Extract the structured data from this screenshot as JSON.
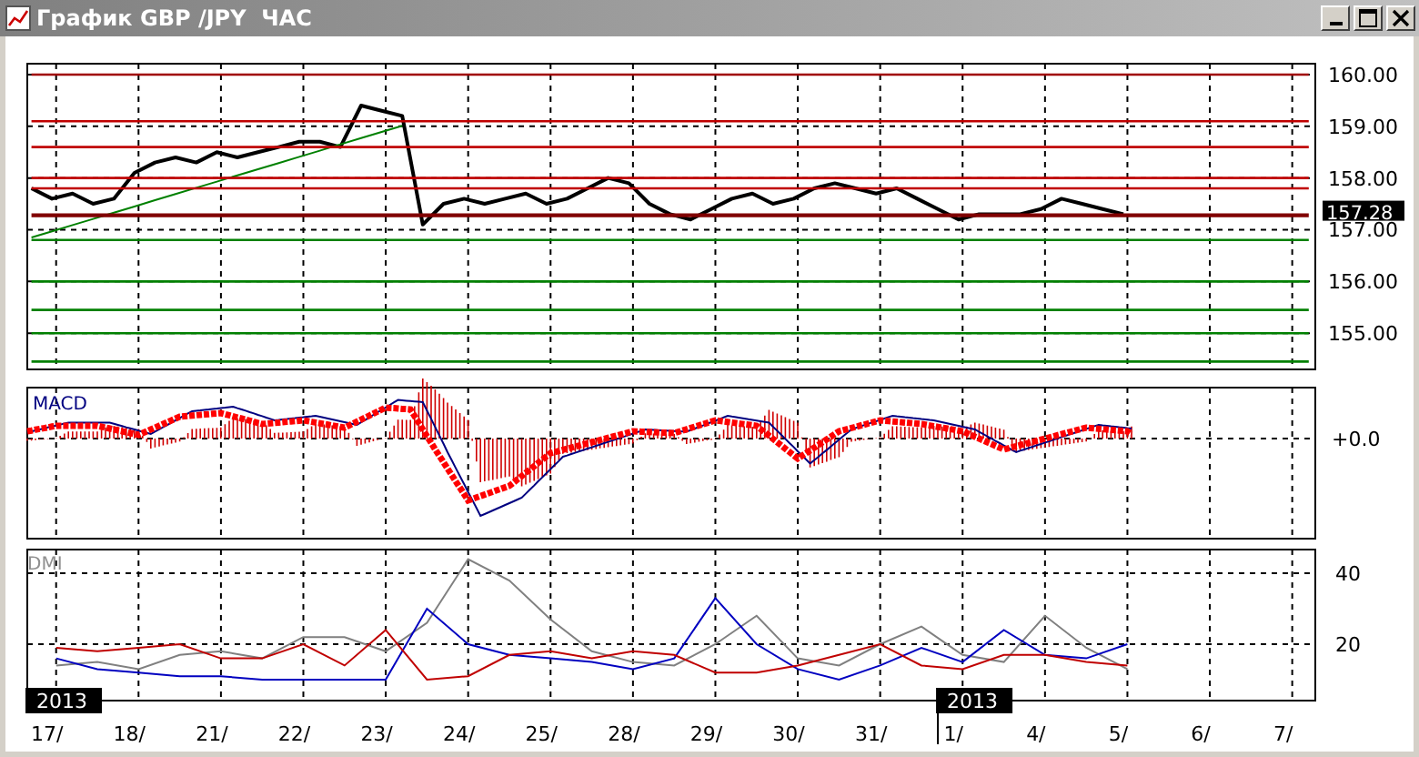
{
  "window": {
    "title": "График GBP /JPY  ЧАС"
  },
  "price_pane": {
    "last_price_label": "157.28",
    "chart_data": {
      "type": "line",
      "categories": [
        null,
        null,
        null,
        null,
        null,
        null,
        null,
        null,
        null,
        null,
        null,
        null,
        null,
        null,
        null,
        null,
        null,
        null,
        null,
        null,
        null,
        null,
        null,
        null,
        null,
        null,
        null,
        null,
        null,
        null,
        null,
        null,
        null,
        null,
        null,
        null,
        null,
        null,
        null,
        null,
        null,
        null,
        null,
        null,
        null,
        null,
        null,
        null,
        null,
        null,
        null,
        null,
        null,
        null,
        null,
        null,
        null,
        null,
        null,
        null,
        null,
        null,
        null
      ],
      "series": [
        {
          "color": "#000000",
          "values": [
            157.8,
            157.6,
            157.7,
            157.5,
            157.6,
            158.1,
            158.3,
            158.4,
            158.3,
            158.5,
            158.4,
            158.5,
            158.6,
            158.7,
            158.7,
            158.6,
            159.4,
            159.3,
            159.2,
            157.1,
            157.5,
            157.6,
            157.5,
            157.6,
            157.7,
            157.5,
            157.6,
            157.8,
            158.0,
            157.9,
            157.5,
            157.3,
            157.2,
            157.4,
            157.6,
            157.7,
            157.5,
            157.6,
            157.8,
            157.9,
            157.8,
            157.7,
            157.8,
            157.6,
            157.4,
            157.2,
            157.3,
            157.3,
            157.3,
            157.4,
            157.6,
            157.5,
            157.4,
            157.3,
            null,
            null,
            null,
            null,
            null,
            null,
            null,
            null,
            null
          ]
        },
        {
          "color": "#008000",
          "values": [
            156.85,
            156.97,
            157.09,
            157.21,
            157.33,
            157.45,
            157.57,
            157.69,
            157.81,
            157.93,
            158.05,
            158.17,
            158.29,
            158.41,
            158.53,
            158.65,
            158.77,
            158.89,
            159.01,
            null,
            null,
            null,
            null,
            null,
            null,
            null,
            null,
            null,
            null,
            null,
            null,
            null,
            null,
            null,
            null,
            null,
            null,
            null,
            null,
            null,
            null,
            null,
            null,
            null,
            null,
            null,
            null,
            null,
            null,
            null,
            null,
            null,
            null,
            null,
            null,
            null,
            null,
            null,
            null,
            null,
            null,
            null,
            null
          ]
        },
        {
          "color": "#a00000",
          "values": [
            160,
            160,
            160,
            160,
            160,
            160,
            160,
            160,
            160,
            160,
            160,
            160,
            160,
            160,
            160,
            160,
            160,
            160,
            160,
            160,
            160,
            160,
            160,
            160,
            160,
            160,
            160,
            160,
            160,
            160,
            160,
            160,
            160,
            160,
            160,
            160,
            160,
            160,
            160,
            160,
            160,
            160,
            160,
            160,
            160,
            160,
            160,
            160,
            160,
            160,
            160,
            160,
            160,
            160,
            160,
            160,
            160,
            160,
            160,
            160,
            160,
            160,
            160
          ]
        },
        {
          "color": "#c00000",
          "values": [
            159.1,
            159.1,
            159.1,
            159.1,
            159.1,
            159.1,
            159.1,
            159.1,
            159.1,
            159.1,
            159.1,
            159.1,
            159.1,
            159.1,
            159.1,
            159.1,
            159.1,
            159.1,
            159.1,
            159.1,
            159.1,
            159.1,
            159.1,
            159.1,
            159.1,
            159.1,
            159.1,
            159.1,
            159.1,
            159.1,
            159.1,
            159.1,
            159.1,
            159.1,
            159.1,
            159.1,
            159.1,
            159.1,
            159.1,
            159.1,
            159.1,
            159.1,
            159.1,
            159.1,
            159.1,
            159.1,
            159.1,
            159.1,
            159.1,
            159.1,
            159.1,
            159.1,
            159.1,
            159.1,
            159.1,
            159.1,
            159.1,
            159.1,
            159.1,
            159.1,
            159.1,
            159.1,
            159.1
          ]
        },
        {
          "color": "#c00000",
          "values": [
            158.6,
            158.6,
            158.6,
            158.6,
            158.6,
            158.6,
            158.6,
            158.6,
            158.6,
            158.6,
            158.6,
            158.6,
            158.6,
            158.6,
            158.6,
            158.6,
            158.6,
            158.6,
            158.6,
            158.6,
            158.6,
            158.6,
            158.6,
            158.6,
            158.6,
            158.6,
            158.6,
            158.6,
            158.6,
            158.6,
            158.6,
            158.6,
            158.6,
            158.6,
            158.6,
            158.6,
            158.6,
            158.6,
            158.6,
            158.6,
            158.6,
            158.6,
            158.6,
            158.6,
            158.6,
            158.6,
            158.6,
            158.6,
            158.6,
            158.6,
            158.6,
            158.6,
            158.6,
            158.6,
            158.6,
            158.6,
            158.6,
            158.6,
            158.6,
            158.6,
            158.6,
            158.6,
            158.6
          ]
        },
        {
          "color": "#c00000",
          "values": [
            158,
            158,
            158,
            158,
            158,
            158,
            158,
            158,
            158,
            158,
            158,
            158,
            158,
            158,
            158,
            158,
            158,
            158,
            158,
            158,
            158,
            158,
            158,
            158,
            158,
            158,
            158,
            158,
            158,
            158,
            158,
            158,
            158,
            158,
            158,
            158,
            158,
            158,
            158,
            158,
            158,
            158,
            158,
            158,
            158,
            158,
            158,
            158,
            158,
            158,
            158,
            158,
            158,
            158,
            158,
            158,
            158,
            158,
            158,
            158,
            158,
            158,
            158
          ]
        },
        {
          "color": "#c00000",
          "values": [
            157.8,
            157.8,
            157.8,
            157.8,
            157.8,
            157.8,
            157.8,
            157.8,
            157.8,
            157.8,
            157.8,
            157.8,
            157.8,
            157.8,
            157.8,
            157.8,
            157.8,
            157.8,
            157.8,
            157.8,
            157.8,
            157.8,
            157.8,
            157.8,
            157.8,
            157.8,
            157.8,
            157.8,
            157.8,
            157.8,
            157.8,
            157.8,
            157.8,
            157.8,
            157.8,
            157.8,
            157.8,
            157.8,
            157.8,
            157.8,
            157.8,
            157.8,
            157.8,
            157.8,
            157.8,
            157.8,
            157.8,
            157.8,
            157.8,
            157.8,
            157.8,
            157.8,
            157.8,
            157.8,
            157.8,
            157.8,
            157.8,
            157.8,
            157.8,
            157.8,
            157.8,
            157.8,
            157.8
          ]
        },
        {
          "color": "#800000",
          "values": [
            157.28,
            157.28,
            157.28,
            157.28,
            157.28,
            157.28,
            157.28,
            157.28,
            157.28,
            157.28,
            157.28,
            157.28,
            157.28,
            157.28,
            157.28,
            157.28,
            157.28,
            157.28,
            157.28,
            157.28,
            157.28,
            157.28,
            157.28,
            157.28,
            157.28,
            157.28,
            157.28,
            157.28,
            157.28,
            157.28,
            157.28,
            157.28,
            157.28,
            157.28,
            157.28,
            157.28,
            157.28,
            157.28,
            157.28,
            157.28,
            157.28,
            157.28,
            157.28,
            157.28,
            157.28,
            157.28,
            157.28,
            157.28,
            157.28,
            157.28,
            157.28,
            157.28,
            157.28,
            157.28,
            157.28,
            157.28,
            157.28,
            157.28,
            157.28,
            157.28,
            157.28,
            157.28,
            157.28
          ]
        },
        {
          "color": "#008000",
          "values": [
            156.8,
            156.8,
            156.8,
            156.8,
            156.8,
            156.8,
            156.8,
            156.8,
            156.8,
            156.8,
            156.8,
            156.8,
            156.8,
            156.8,
            156.8,
            156.8,
            156.8,
            156.8,
            156.8,
            156.8,
            156.8,
            156.8,
            156.8,
            156.8,
            156.8,
            156.8,
            156.8,
            156.8,
            156.8,
            156.8,
            156.8,
            156.8,
            156.8,
            156.8,
            156.8,
            156.8,
            156.8,
            156.8,
            156.8,
            156.8,
            156.8,
            156.8,
            156.8,
            156.8,
            156.8,
            156.8,
            156.8,
            156.8,
            156.8,
            156.8,
            156.8,
            156.8,
            156.8,
            156.8,
            156.8,
            156.8,
            156.8,
            156.8,
            156.8,
            156.8,
            156.8,
            156.8,
            156.8
          ]
        },
        {
          "color": "#008000",
          "values": [
            156,
            156,
            156,
            156,
            156,
            156,
            156,
            156,
            156,
            156,
            156,
            156,
            156,
            156,
            156,
            156,
            156,
            156,
            156,
            156,
            156,
            156,
            156,
            156,
            156,
            156,
            156,
            156,
            156,
            156,
            156,
            156,
            156,
            156,
            156,
            156,
            156,
            156,
            156,
            156,
            156,
            156,
            156,
            156,
            156,
            156,
            156,
            156,
            156,
            156,
            156,
            156,
            156,
            156,
            156,
            156,
            156,
            156,
            156,
            156,
            156,
            156,
            156
          ]
        },
        {
          "color": "#008000",
          "values": [
            155.45,
            155.45,
            155.45,
            155.45,
            155.45,
            155.45,
            155.45,
            155.45,
            155.45,
            155.45,
            155.45,
            155.45,
            155.45,
            155.45,
            155.45,
            155.45,
            155.45,
            155.45,
            155.45,
            155.45,
            155.45,
            155.45,
            155.45,
            155.45,
            155.45,
            155.45,
            155.45,
            155.45,
            155.45,
            155.45,
            155.45,
            155.45,
            155.45,
            155.45,
            155.45,
            155.45,
            155.45,
            155.45,
            155.45,
            155.45,
            155.45,
            155.45,
            155.45,
            155.45,
            155.45,
            155.45,
            155.45,
            155.45,
            155.45,
            155.45,
            155.45,
            155.45,
            155.45,
            155.45,
            155.45,
            155.45,
            155.45,
            155.45,
            155.45,
            155.45,
            155.45,
            155.45,
            155.45
          ]
        },
        {
          "color": "#008000",
          "values": [
            155,
            155,
            155,
            155,
            155,
            155,
            155,
            155,
            155,
            155,
            155,
            155,
            155,
            155,
            155,
            155,
            155,
            155,
            155,
            155,
            155,
            155,
            155,
            155,
            155,
            155,
            155,
            155,
            155,
            155,
            155,
            155,
            155,
            155,
            155,
            155,
            155,
            155,
            155,
            155,
            155,
            155,
            155,
            155,
            155,
            155,
            155,
            155,
            155,
            155,
            155,
            155,
            155,
            155,
            155,
            155,
            155,
            155,
            155,
            155,
            155,
            155,
            155
          ]
        },
        {
          "color": "#008000",
          "values": [
            154.45,
            154.45,
            154.45,
            154.45,
            154.45,
            154.45,
            154.45,
            154.45,
            154.45,
            154.45,
            154.45,
            154.45,
            154.45,
            154.45,
            154.45,
            154.45,
            154.45,
            154.45,
            154.45,
            154.45,
            154.45,
            154.45,
            154.45,
            154.45,
            154.45,
            154.45,
            154.45,
            154.45,
            154.45,
            154.45,
            154.45,
            154.45,
            154.45,
            154.45,
            154.45,
            154.45,
            154.45,
            154.45,
            154.45,
            154.45,
            154.45,
            154.45,
            154.45,
            154.45,
            154.45,
            154.45,
            154.45,
            154.45,
            154.45,
            154.45,
            154.45,
            154.45,
            154.45,
            154.45,
            154.45,
            154.45,
            154.45,
            154.45,
            154.45,
            154.45,
            154.45,
            154.45,
            154.45
          ]
        }
      ],
      "ylim": [
        154.3,
        160.21
      ],
      "yticks": [
        {
          "value": 160,
          "label": "160.00"
        },
        {
          "value": 159,
          "label": "159.00"
        },
        {
          "value": 158,
          "label": "158.00"
        },
        {
          "value": 157,
          "label": "157.00"
        },
        {
          "value": 156,
          "label": "156.00"
        },
        {
          "value": 155,
          "label": "155.00"
        }
      ],
      "grid": true
    }
  },
  "macd_pane": {
    "title": "MACD",
    "zero_label": "+0.0"
  },
  "dmi_pane": {
    "title": "DMI",
    "chart_data": {
      "type": "line",
      "categories": [
        null,
        null,
        null,
        null,
        null,
        null,
        null,
        null,
        null,
        null,
        null,
        null,
        null,
        null,
        null,
        null,
        null,
        null,
        null,
        null,
        null,
        null,
        null,
        null,
        null,
        null,
        null
      ],
      "series": [
        {
          "color": "#808080",
          "values": [
            14,
            15,
            13,
            17,
            18,
            16,
            22,
            22,
            18,
            26,
            44,
            38,
            27,
            18,
            15,
            14,
            20,
            28,
            16,
            14,
            20,
            25,
            17,
            15,
            28,
            19,
            13
          ]
        },
        {
          "color": "#0000c0",
          "values": [
            16,
            13,
            12,
            11,
            11,
            10,
            10,
            10,
            10,
            30,
            20,
            17,
            16,
            15,
            13,
            16,
            33,
            20,
            13,
            10,
            14,
            19,
            15,
            24,
            17,
            16,
            20
          ]
        },
        {
          "color": "#c00000",
          "values": [
            19,
            18,
            19,
            20,
            16,
            16,
            20,
            14,
            24,
            10,
            11,
            17,
            18,
            16,
            18,
            17,
            12,
            12,
            14,
            17,
            20,
            14,
            13,
            17,
            17,
            15,
            14
          ]
        }
      ],
      "ylim": [
        4.1,
        46.7
      ],
      "yticks": [
        {
          "value": 20,
          "label": "20"
        },
        {
          "value": 40,
          "label": "40"
        }
      ],
      "grid": true
    }
  },
  "time_axis": {
    "labels": [
      "17/",
      "18/",
      "21/",
      "22/",
      "23/",
      "24/",
      "25/",
      "28/",
      "29/",
      "30/",
      "31/",
      "1/",
      "4/",
      "5/",
      "6/",
      "7/"
    ],
    "year_markers": [
      {
        "label": "2013"
      },
      {
        "label": "2013"
      }
    ]
  }
}
